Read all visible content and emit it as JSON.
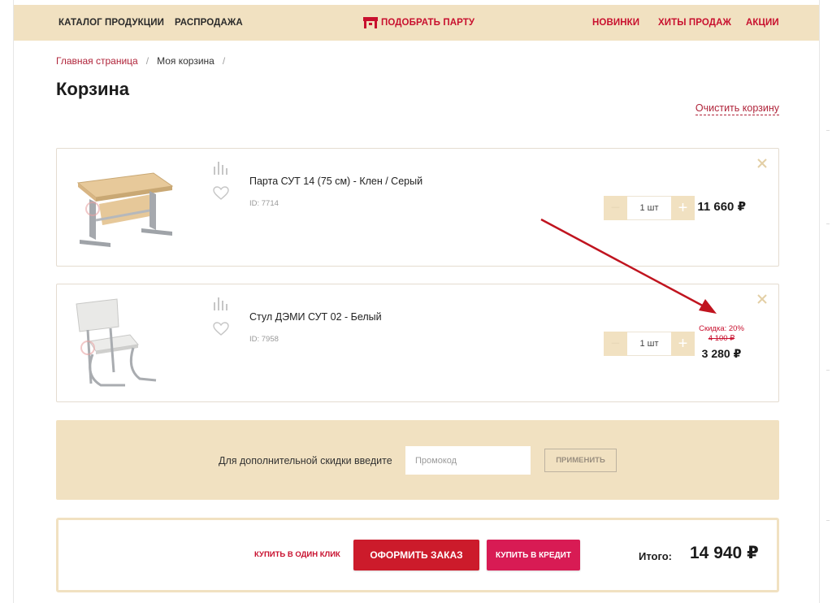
{
  "nav": {
    "catalog": "Каталог продукции",
    "sale": "Распродажа",
    "pick_desk": "Подобрать парту",
    "new": "Новинки",
    "hits": "Хиты продаж",
    "promotions": "Акции"
  },
  "breadcrumb": {
    "home": "Главная страница",
    "current": "Моя корзина",
    "separator": "/"
  },
  "page_title": "Корзина",
  "clear_cart": "Очистить корзину",
  "items": [
    {
      "title": "Парта СУТ 14 (75 см) - Клен / Серый",
      "id": "ID: 7714",
      "qty": "1 шт",
      "price": "11 660 ₽"
    },
    {
      "title": "Стул ДЭМИ СУТ 02 - Белый",
      "id": "ID: 7958",
      "qty": "1 шт",
      "discount_label": "Скидка: 20%",
      "old_price": "4 100 ₽",
      "price": "3 280 ₽"
    }
  ],
  "qty_controls": {
    "minus": "−",
    "plus": "+"
  },
  "promo": {
    "label": "Для дополнительной скидки введите",
    "placeholder": "Промокод",
    "apply": "Применить"
  },
  "order": {
    "one_click": "Купить в один клик",
    "checkout": "Оформить заказ",
    "credit": "Купить в кредит",
    "total_label": "Итого:",
    "total_value": "14 940 ₽"
  },
  "colors": {
    "beige": "#f1e1c1",
    "brand_red": "#cc1b2b",
    "credit_pink": "#d81b54",
    "link_red": "#b0243a",
    "annotation_arrow": "#c0141f"
  }
}
